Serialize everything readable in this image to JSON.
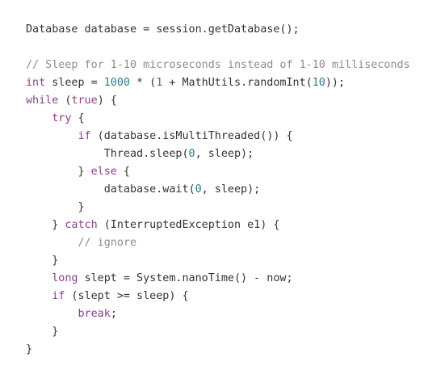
{
  "code": {
    "lines": [
      [
        {
          "t": "Database database = session.getDatabase();",
          "c": "pl"
        }
      ],
      [],
      [
        {
          "t": "// Sleep for 1-10 microseconds instead of 1-10 milliseconds",
          "c": "cm"
        }
      ],
      [
        {
          "t": "int",
          "c": "kw"
        },
        {
          "t": " sleep = ",
          "c": "pl"
        },
        {
          "t": "1000",
          "c": "num"
        },
        {
          "t": " * (",
          "c": "pl"
        },
        {
          "t": "1",
          "c": "num"
        },
        {
          "t": " + MathUtils.randomInt(",
          "c": "pl"
        },
        {
          "t": "10",
          "c": "num"
        },
        {
          "t": "));",
          "c": "pl"
        }
      ],
      [
        {
          "t": "while",
          "c": "kw"
        },
        {
          "t": " (",
          "c": "pl"
        },
        {
          "t": "true",
          "c": "kw"
        },
        {
          "t": ") {",
          "c": "pl"
        }
      ],
      [
        {
          "t": "    ",
          "c": "pl"
        },
        {
          "t": "try",
          "c": "kw"
        },
        {
          "t": " {",
          "c": "pl"
        }
      ],
      [
        {
          "t": "        ",
          "c": "pl"
        },
        {
          "t": "if",
          "c": "kw"
        },
        {
          "t": " (database.isMultiThreaded()) {",
          "c": "pl"
        }
      ],
      [
        {
          "t": "            Thread.sleep(",
          "c": "pl"
        },
        {
          "t": "0",
          "c": "num"
        },
        {
          "t": ", sleep);",
          "c": "pl"
        }
      ],
      [
        {
          "t": "        } ",
          "c": "pl"
        },
        {
          "t": "else",
          "c": "kw"
        },
        {
          "t": " {",
          "c": "pl"
        }
      ],
      [
        {
          "t": "            database.wait(",
          "c": "pl"
        },
        {
          "t": "0",
          "c": "num"
        },
        {
          "t": ", sleep);",
          "c": "pl"
        }
      ],
      [
        {
          "t": "        }",
          "c": "pl"
        }
      ],
      [
        {
          "t": "    } ",
          "c": "pl"
        },
        {
          "t": "catch",
          "c": "kw"
        },
        {
          "t": " (InterruptedException e1) {",
          "c": "pl"
        }
      ],
      [
        {
          "t": "        ",
          "c": "pl"
        },
        {
          "t": "// ignore",
          "c": "cm"
        }
      ],
      [
        {
          "t": "    }",
          "c": "pl"
        }
      ],
      [
        {
          "t": "    ",
          "c": "pl"
        },
        {
          "t": "long",
          "c": "kw"
        },
        {
          "t": " slept = System.nanoTime() - now;",
          "c": "pl"
        }
      ],
      [
        {
          "t": "    ",
          "c": "pl"
        },
        {
          "t": "if",
          "c": "kw"
        },
        {
          "t": " (slept >= sleep) {",
          "c": "pl"
        }
      ],
      [
        {
          "t": "        ",
          "c": "pl"
        },
        {
          "t": "break",
          "c": "kw"
        },
        {
          "t": ";",
          "c": "pl"
        }
      ],
      [
        {
          "t": "    }",
          "c": "pl"
        }
      ],
      [
        {
          "t": "}",
          "c": "pl"
        }
      ]
    ]
  }
}
